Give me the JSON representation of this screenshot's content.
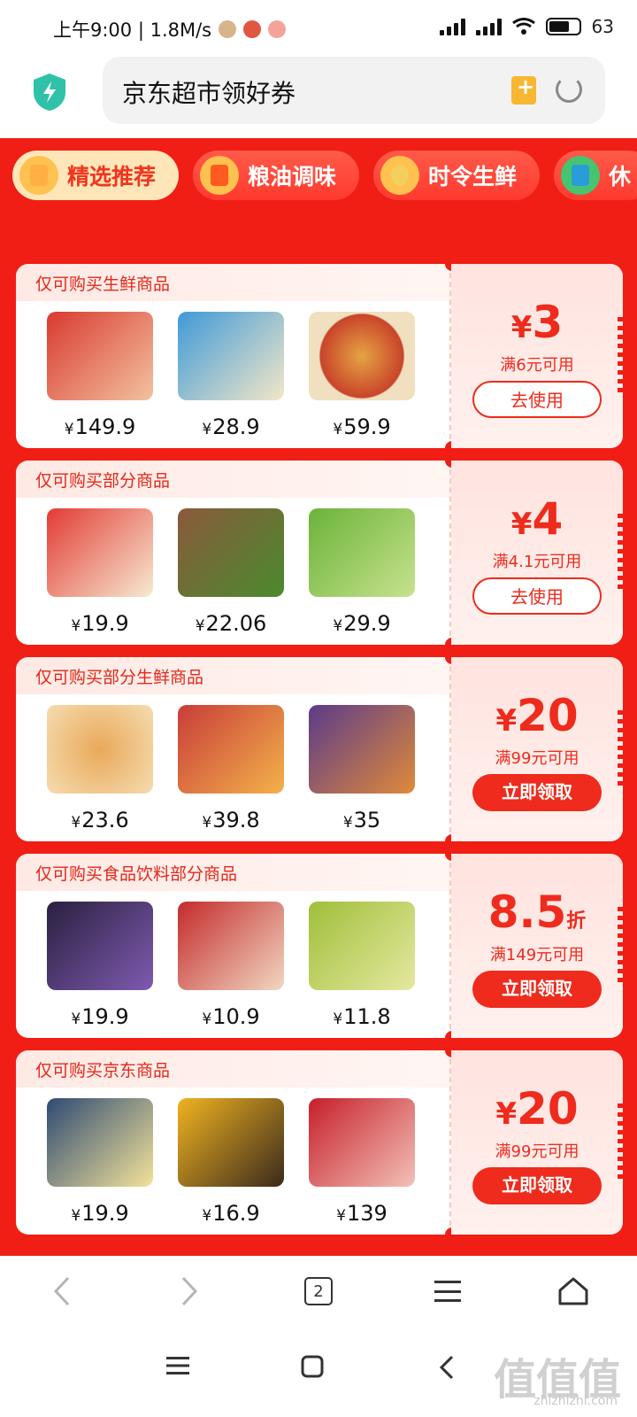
{
  "status": {
    "time_speed": "上午9:00 | 1.8M/s",
    "battery": "63"
  },
  "address": {
    "url_text": "京东超市领好券"
  },
  "tabs": [
    {
      "label": "精选推荐",
      "active": true
    },
    {
      "label": "粮油调味",
      "active": false
    },
    {
      "label": "时令生鲜",
      "active": false
    },
    {
      "label": "休",
      "active": false
    }
  ],
  "cards": [
    {
      "title": "仅可购买生鲜商品",
      "products": [
        {
          "price": "149.9"
        },
        {
          "price": "28.9"
        },
        {
          "price": "59.9"
        }
      ],
      "amount": "3",
      "currency": "¥",
      "unit": "",
      "condition": "满6元可用",
      "button": "去使用",
      "button_style": "outline"
    },
    {
      "title": "仅可购买部分商品",
      "products": [
        {
          "price": "19.9"
        },
        {
          "price": "22.06"
        },
        {
          "price": "29.9"
        }
      ],
      "amount": "4",
      "currency": "¥",
      "unit": "",
      "condition": "满4.1元可用",
      "button": "去使用",
      "button_style": "outline"
    },
    {
      "title": "仅可购买部分生鲜商品",
      "products": [
        {
          "price": "23.6"
        },
        {
          "price": "39.8"
        },
        {
          "price": "35"
        }
      ],
      "amount": "20",
      "currency": "¥",
      "unit": "",
      "condition": "满99元可用",
      "button": "立即领取",
      "button_style": "fill"
    },
    {
      "title": "仅可购买食品饮料部分商品",
      "products": [
        {
          "price": "19.9"
        },
        {
          "price": "10.9"
        },
        {
          "price": "11.8"
        }
      ],
      "amount": "8.5",
      "currency": "",
      "unit": "折",
      "condition": "满149元可用",
      "button": "立即领取",
      "button_style": "fill"
    },
    {
      "title": "仅可购买京东商品",
      "products": [
        {
          "price": "19.9"
        },
        {
          "price": "16.9"
        },
        {
          "price": "139"
        }
      ],
      "amount": "20",
      "currency": "¥",
      "unit": "",
      "condition": "满99元可用",
      "button": "立即领取",
      "button_style": "fill"
    }
  ],
  "price_symbol": "¥",
  "browser_nav": {
    "tab_count": "2"
  },
  "watermark": {
    "main": "值值值",
    "sub": "zhizhizhi.com"
  },
  "colors": {
    "brand_red": "#f01e14",
    "accent_red": "#ee2b1c",
    "tab_active_bg": "#ffe6b8"
  }
}
